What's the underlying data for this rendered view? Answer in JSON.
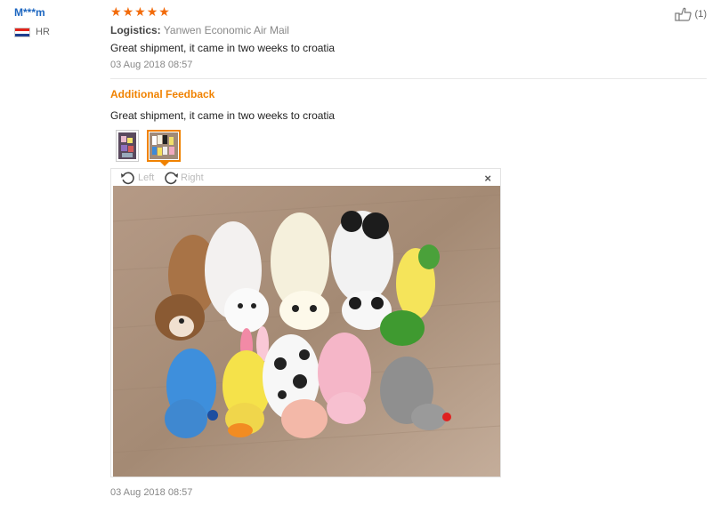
{
  "reviewer": {
    "name": "M***m",
    "country": "HR"
  },
  "rating": {
    "stars": 5,
    "of": 5,
    "color": "#f26b0b"
  },
  "logistics": {
    "label": "Logistics:",
    "value": "Yanwen Economic Air Mail"
  },
  "review": {
    "text": "Great shipment, it came in two weeks to croatia",
    "date": "03 Aug 2018 08:57"
  },
  "helpful": {
    "icon": "thumbs-up-icon",
    "count": "(1)"
  },
  "additional_feedback": {
    "title": "Additional Feedback",
    "text": "Great shipment, it came in two weeks to croatia",
    "date": "03 Aug 2018 08:57"
  },
  "viewer": {
    "rotate_left": "Left",
    "rotate_right": "Right",
    "close": "×"
  },
  "colors": {
    "accent": "#f08200",
    "link": "#1c66c0"
  }
}
